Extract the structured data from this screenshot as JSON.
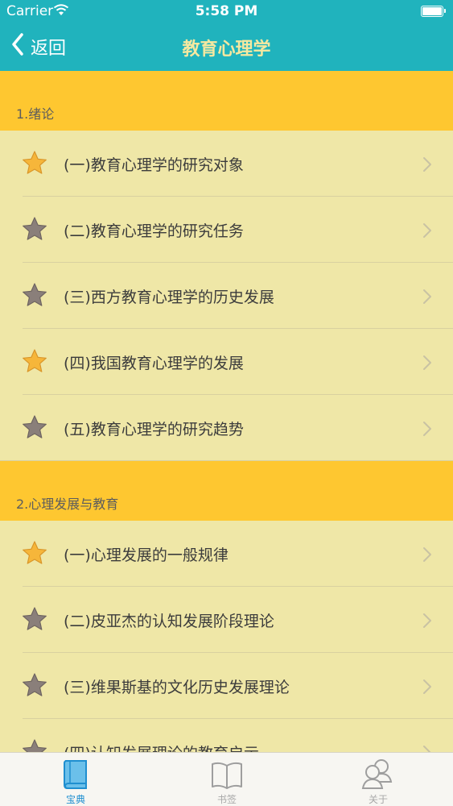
{
  "status_bar": {
    "carrier": "Carrier",
    "time": "5:58 PM"
  },
  "nav": {
    "back_label": "返回",
    "title": "教育心理学"
  },
  "sections": [
    {
      "title": "1.绪论",
      "items": [
        {
          "label": "(一)教育心理学的研究对象",
          "starred": true
        },
        {
          "label": "(二)教育心理学的研究任务",
          "starred": false
        },
        {
          "label": "(三)西方教育心理学的历史发展",
          "starred": false
        },
        {
          "label": "(四)我国教育心理学的发展",
          "starred": true
        },
        {
          "label": "(五)教育心理学的研究趋势",
          "starred": false
        }
      ]
    },
    {
      "title": "2.心理发展与教育",
      "items": [
        {
          "label": "(一)心理发展的一般规律",
          "starred": true
        },
        {
          "label": "(二)皮亚杰的认知发展阶段理论",
          "starred": false
        },
        {
          "label": "(三)维果斯基的文化历史发展理论",
          "starred": false
        },
        {
          "label": "(四)认知发展理论的教育启示",
          "starred": false
        }
      ]
    }
  ],
  "tabs": [
    {
      "label": "宝典",
      "icon": "book-icon",
      "active": true
    },
    {
      "label": "书签",
      "icon": "open-book-icon",
      "active": false
    },
    {
      "label": "关于",
      "icon": "people-icon",
      "active": false
    }
  ],
  "colors": {
    "nav_bar": "#20b3bd",
    "section_header": "#fec730",
    "list_background": "#efe7a7",
    "star_gold": "#f6b63a",
    "star_gray": "#8a7f7a",
    "tab_active": "#1f8fd0"
  }
}
